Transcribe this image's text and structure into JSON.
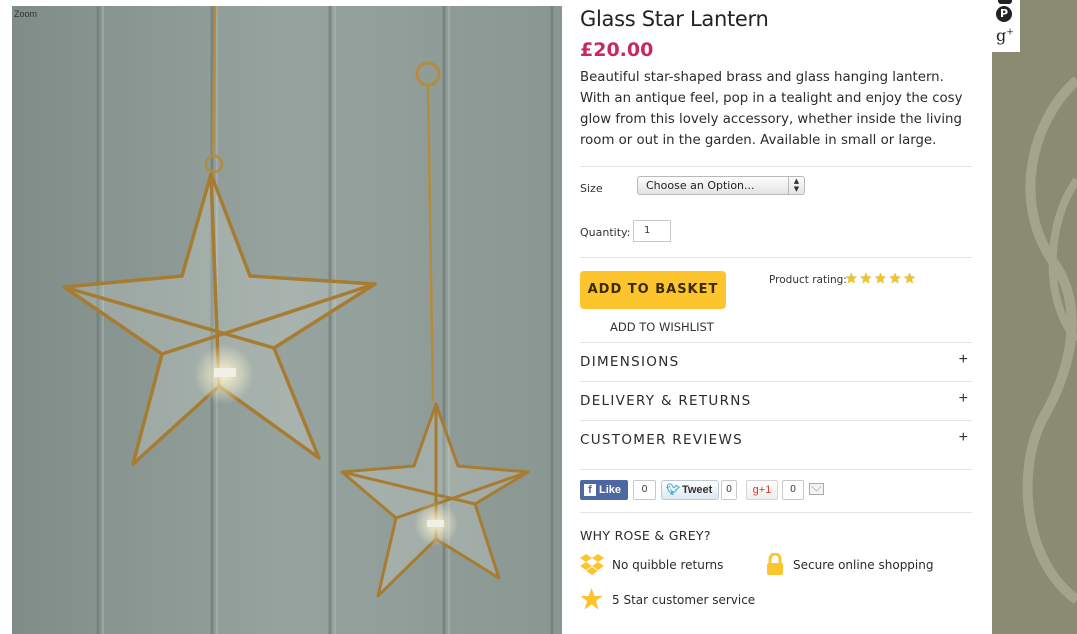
{
  "gallery": {
    "zoom_label": "Zoom",
    "image_alt": "Two brass and glass star lanterns hanging against a grey panelled wall"
  },
  "product": {
    "title": "Glass Star Lantern",
    "price": "£20.00",
    "description": "Beautiful star-shaped brass and glass hanging lantern. With an antique feel, pop in a tealight and enjoy the cosy glow from this lovely accessory, whether inside the living room or out in the garden. Available in small or large."
  },
  "options": {
    "size_label": "Size",
    "size_selected": "Choose an Option...",
    "quantity_label": "Quantity:",
    "quantity_value": "1"
  },
  "actions": {
    "add_to_basket": "ADD TO BASKET",
    "add_to_wishlist": "ADD TO WISHLIST"
  },
  "rating": {
    "label": "Product rating:",
    "stars": 5,
    "star_glyph": "★"
  },
  "accordion": [
    {
      "label": "DIMENSIONS",
      "toggle": "+"
    },
    {
      "label": "DELIVERY & RETURNS",
      "toggle": "+"
    },
    {
      "label": "CUSTOMER REVIEWS",
      "toggle": "+"
    }
  ],
  "social": {
    "like_label": "Like",
    "like_count": "0",
    "tweet_label": "Tweet",
    "tweet_count": "0",
    "gplus_label": "g+1",
    "gplus_count": "0"
  },
  "why": {
    "title": "WHY ROSE & GREY?",
    "items": [
      {
        "icon": "dropbox-icon",
        "label": "No quibble returns"
      },
      {
        "icon": "lock-icon",
        "label": "Secure online shopping"
      },
      {
        "icon": "star-icon",
        "label": "5 Star customer service"
      }
    ]
  },
  "colors": {
    "accent_price": "#c6285f",
    "button_yellow": "#fdc52d",
    "side_panel": "#8b8a72"
  }
}
